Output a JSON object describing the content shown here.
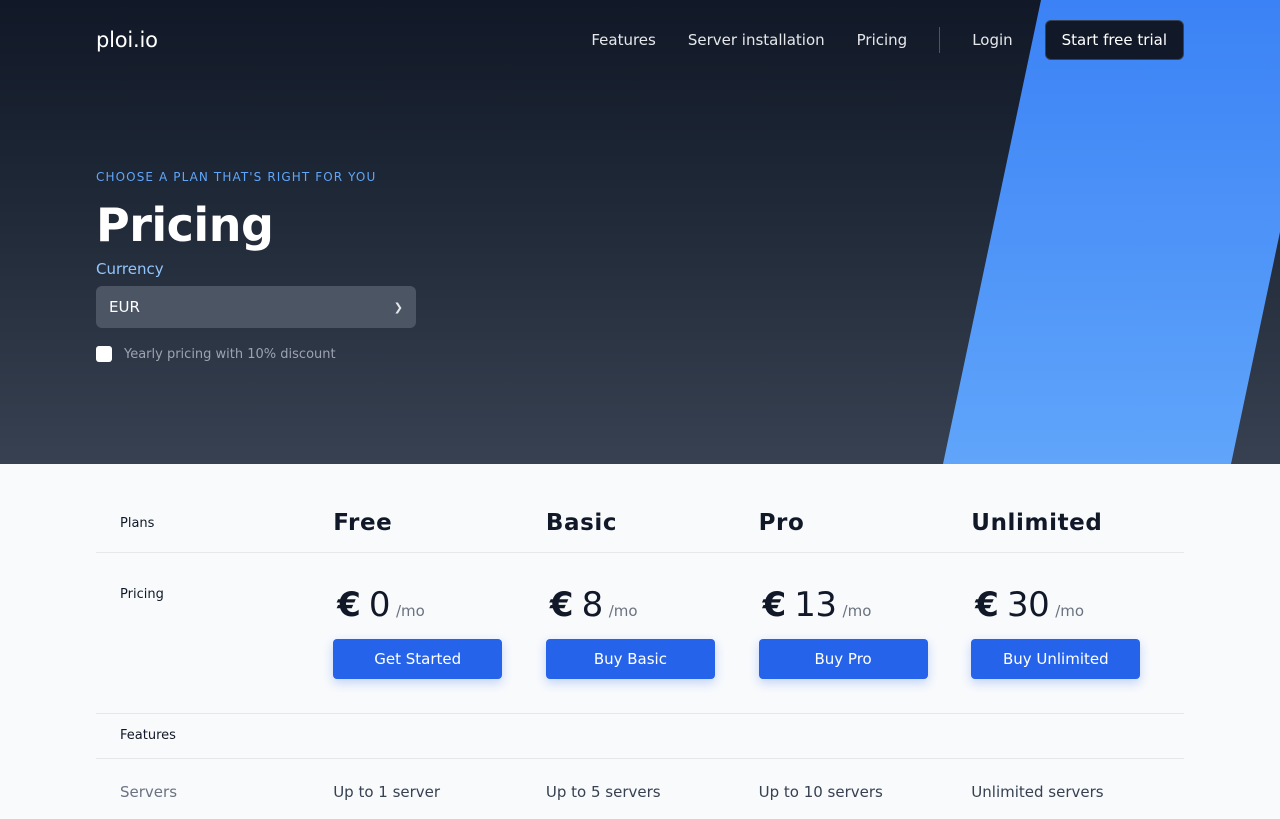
{
  "nav": {
    "logo": "ploi.io",
    "links": [
      "Features",
      "Server installation",
      "Pricing"
    ],
    "login": "Login",
    "cta": "Start free trial"
  },
  "hero": {
    "eyebrow": "Choose a plan that's right for you",
    "title": "Pricing",
    "currency_label": "Currency",
    "currency_selected": "EUR",
    "yearly_label": "Yearly pricing with 10% discount",
    "yearly_checked": false
  },
  "table": {
    "plans_label": "Plans",
    "pricing_label": "Pricing",
    "features_label": "Features",
    "servers_label": "Servers",
    "plans": [
      {
        "name": "Free",
        "currency": "€",
        "price": "0",
        "period": "/mo",
        "button": "Get Started",
        "servers": "Up to 1 server"
      },
      {
        "name": "Basic",
        "currency": "€",
        "price": "8",
        "period": "/mo",
        "button": "Buy Basic",
        "servers": "Up to 5 servers"
      },
      {
        "name": "Pro",
        "currency": "€",
        "price": "13",
        "period": "/mo",
        "button": "Buy Pro",
        "servers": "Up to 10 servers"
      },
      {
        "name": "Unlimited",
        "currency": "€",
        "price": "30",
        "period": "/mo",
        "button": "Buy Unlimited",
        "servers": "Unlimited servers"
      }
    ]
  },
  "colors": {
    "accent": "#2563eb",
    "hero_dark": "#111827",
    "hero_blue": "#3b82f6",
    "eyebrow": "#60a5fa"
  },
  "icons": {
    "select": "chevron-down-icon"
  }
}
